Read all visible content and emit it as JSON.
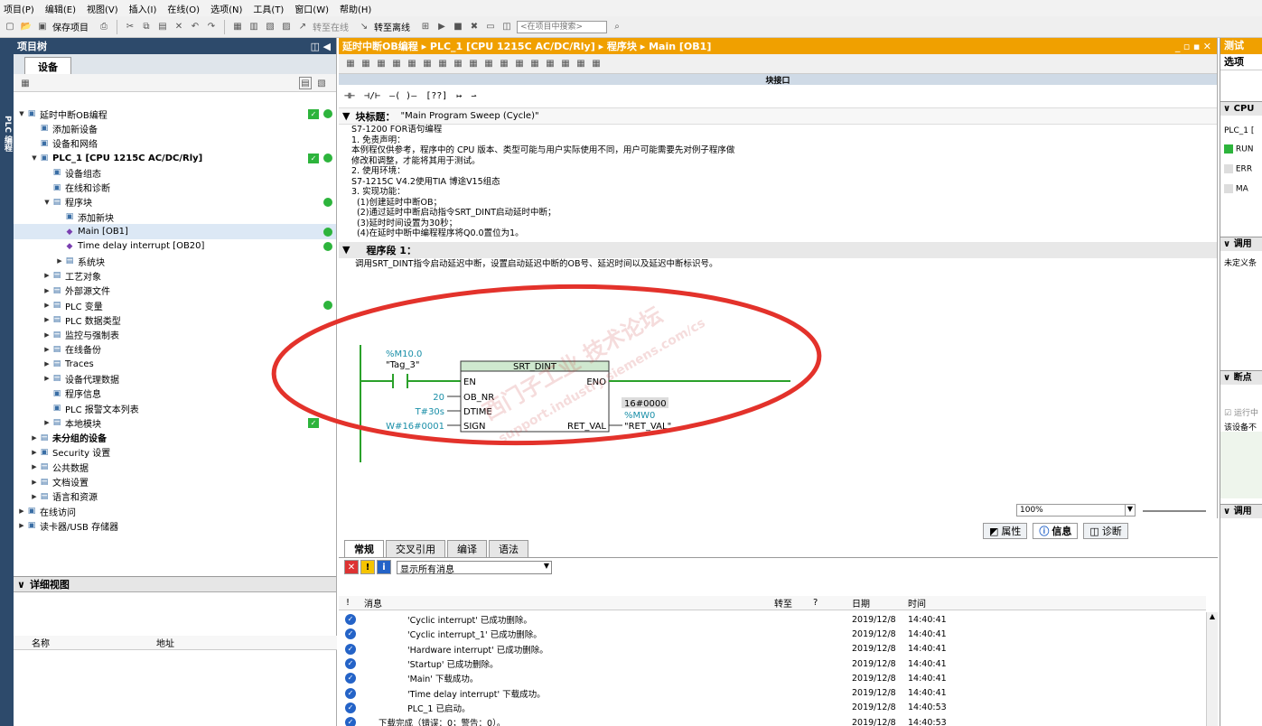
{
  "menu": [
    "项目(P)",
    "编辑(E)",
    "视图(V)",
    "插入(I)",
    "在线(O)",
    "选项(N)",
    "工具(T)",
    "窗口(W)",
    "帮助(H)"
  ],
  "toolbar": {
    "save_project": "保存项目",
    "go_online": "转至在线",
    "go_offline": "转至离线",
    "search_placeholder": "<在项目中搜索>"
  },
  "side_strip_label": "PLC 编程",
  "project_tree": {
    "title": "项目树",
    "devices_tab": "设备",
    "items": [
      {
        "label": "延时中断OB编程",
        "depth": 0,
        "twist": "▼",
        "icon": "project-icon",
        "check": true,
        "dot": true
      },
      {
        "label": "添加新设备",
        "depth": 1,
        "twist": "",
        "icon": "add-device-icon"
      },
      {
        "label": "设备和网络",
        "depth": 1,
        "twist": "",
        "icon": "network-icon"
      },
      {
        "label": "PLC_1 [CPU 1215C AC/DC/Rly]",
        "depth": 1,
        "twist": "▼",
        "icon": "plc-icon",
        "bold": true,
        "check": true,
        "dot": true
      },
      {
        "label": "设备组态",
        "depth": 2,
        "twist": "",
        "icon": "device-config-icon"
      },
      {
        "label": "在线和诊断",
        "depth": 2,
        "twist": "",
        "icon": "diagnostics-icon"
      },
      {
        "label": "程序块",
        "depth": 2,
        "twist": "▼",
        "icon": "folder-icon",
        "dot": true
      },
      {
        "label": "添加新块",
        "depth": 3,
        "twist": "",
        "icon": "add-block-icon"
      },
      {
        "label": "Main [OB1]",
        "depth": 3,
        "twist": "",
        "icon": "ob-block-icon",
        "selected": true,
        "dot": true
      },
      {
        "label": "Time delay interrupt [OB20]",
        "depth": 3,
        "twist": "",
        "icon": "ob-block-icon",
        "dot": true
      },
      {
        "label": "系统块",
        "depth": 3,
        "twist": "▶",
        "icon": "folder-icon"
      },
      {
        "label": "工艺对象",
        "depth": 2,
        "twist": "▶",
        "icon": "folder-icon"
      },
      {
        "label": "外部源文件",
        "depth": 2,
        "twist": "▶",
        "icon": "folder-icon"
      },
      {
        "label": "PLC 变量",
        "depth": 2,
        "twist": "▶",
        "icon": "folder-icon",
        "dot": true
      },
      {
        "label": "PLC 数据类型",
        "depth": 2,
        "twist": "▶",
        "icon": "folder-icon"
      },
      {
        "label": "监控与强制表",
        "depth": 2,
        "twist": "▶",
        "icon": "folder-icon"
      },
      {
        "label": "在线备份",
        "depth": 2,
        "twist": "▶",
        "icon": "folder-icon"
      },
      {
        "label": "Traces",
        "depth": 2,
        "twist": "▶",
        "icon": "folder-icon"
      },
      {
        "label": "设备代理数据",
        "depth": 2,
        "twist": "▶",
        "icon": "folder-icon"
      },
      {
        "label": "程序信息",
        "depth": 2,
        "twist": "",
        "icon": "program-info-icon"
      },
      {
        "label": "PLC 报警文本列表",
        "depth": 2,
        "twist": "",
        "icon": "alarm-text-icon"
      },
      {
        "label": "本地模块",
        "depth": 2,
        "twist": "▶",
        "icon": "folder-icon",
        "check": true
      },
      {
        "label": "未分组的设备",
        "depth": 1,
        "twist": "▶",
        "icon": "folder-icon",
        "bold": true
      },
      {
        "label": "Security 设置",
        "depth": 1,
        "twist": "▶",
        "icon": "security-icon"
      },
      {
        "label": "公共数据",
        "depth": 1,
        "twist": "▶",
        "icon": "folder-icon"
      },
      {
        "label": "文档设置",
        "depth": 1,
        "twist": "▶",
        "icon": "folder-icon"
      },
      {
        "label": "语言和资源",
        "depth": 1,
        "twist": "▶",
        "icon": "folder-icon"
      },
      {
        "label": "在线访问",
        "depth": 0,
        "twist": "▶",
        "icon": "online-access-icon"
      },
      {
        "label": "读卡器/USB 存储器",
        "depth": 0,
        "twist": "▶",
        "icon": "card-reader-icon"
      }
    ]
  },
  "detail_view": {
    "title": "详细视图",
    "col_name": "名称",
    "col_address": "地址"
  },
  "editor": {
    "breadcrumb": "延时中断OB编程 ▸ PLC_1 [CPU 1215C AC/DC/Rly] ▸ 程序块 ▸ Main [OB1]",
    "interface_label": "块接口",
    "block_title_label": "块标题：",
    "block_title_value": "\"Main Program Sweep (Cycle)\"",
    "comment_lines": [
      "S7-1200 FOR语句编程",
      "1. 免责声明：",
      "本例程仅供参考，程序中的 CPU 版本、类型可能与用户实际使用不同，用户可能需要先对例子程序做",
      "修改和调整，才能将其用于测试。",
      "2. 使用环境：",
      "S7-1215C V4.2使用TIA 博途V15组态",
      "3. 实现功能：",
      "  (1)创建延时中断OB；",
      "  (2)通过延时中断启动指令SRT_DINT启动延时中断；",
      "  (3)延时时间设置为30秒；",
      "  (4)在延时中断中编程程序将Q0.0置位为1。"
    ],
    "network_label": "程序段 1：",
    "network_comment": "调用SRT_DINT指令启动延迟中断，设置启动延迟中断的OB号、延迟时间以及延迟中断标识号。",
    "zoom": "100%",
    "ladder": {
      "contact_address": "%M10.0",
      "contact_tag": "\"Tag_3\"",
      "block_name": "SRT_DINT",
      "pin_en": "EN",
      "pin_eno": "ENO",
      "pin_ob_nr": "OB_NR",
      "pin_dtime": "DTIME",
      "pin_sign": "SIGN",
      "pin_ret_val": "RET_VAL",
      "ob_nr_value": "20",
      "dtime_value": "T#30s",
      "sign_value": "W#16#0001",
      "ret_val_monitor": "16#0000",
      "ret_val_address": "%MW0",
      "ret_val_tag": "\"RET_VAL\""
    },
    "watermark_line1": "西门子工业 技术论坛",
    "watermark_line2": "support.industry.siemens.com/cs"
  },
  "inspector_tabs": {
    "properties": "属性",
    "info": "信息",
    "diagnostics": "诊断"
  },
  "info_panel": {
    "tabs": [
      "常规",
      "交叉引用",
      "编译",
      "语法"
    ],
    "filter_value": "显示所有消息",
    "columns": {
      "message": "消息",
      "goto": "转至",
      "q": "?",
      "date": "日期",
      "time": "时间"
    },
    "messages": [
      {
        "text": "'Cyclic interrupt' 已成功删除。",
        "date": "2019/12/8",
        "time": "14:40:41",
        "indent": true
      },
      {
        "text": "'Cyclic interrupt_1' 已成功删除。",
        "date": "2019/12/8",
        "time": "14:40:41",
        "indent": true
      },
      {
        "text": "'Hardware interrupt' 已成功删除。",
        "date": "2019/12/8",
        "time": "14:40:41",
        "indent": true
      },
      {
        "text": "'Startup' 已成功删除。",
        "date": "2019/12/8",
        "time": "14:40:41",
        "indent": true
      },
      {
        "text": "'Main' 下载成功。",
        "date": "2019/12/8",
        "time": "14:40:41",
        "indent": true
      },
      {
        "text": "'Time delay interrupt' 下载成功。",
        "date": "2019/12/8",
        "time": "14:40:41",
        "indent": true
      },
      {
        "text": "PLC_1 已启动。",
        "date": "2019/12/8",
        "time": "14:40:53",
        "indent": true
      },
      {
        "text": "下载完成（错误：0；警告：0）。",
        "date": "2019/12/8",
        "time": "14:40:53",
        "indent": false
      }
    ]
  },
  "right_panel": {
    "title": "测试",
    "options_label": "选项",
    "cpu_section": "CPU",
    "plc_label": "PLC_1 [",
    "run_label": "RUN",
    "error_label": "ERR",
    "maint_label": "MA",
    "call_env": "调用",
    "undefined_label": "未定义条",
    "breakpoints": "断点",
    "run_to_label": "运行中",
    "device_not": "该设备不",
    "call_stack": "调用"
  },
  "colors": {
    "accent_orange": "#f0a000",
    "status_green": "#2db43c",
    "ladder_green": "#2aa12a",
    "info_blue": "#2463c7",
    "tree_sidebar": "#2d4a6b",
    "annotation_red": "#e3322b"
  }
}
